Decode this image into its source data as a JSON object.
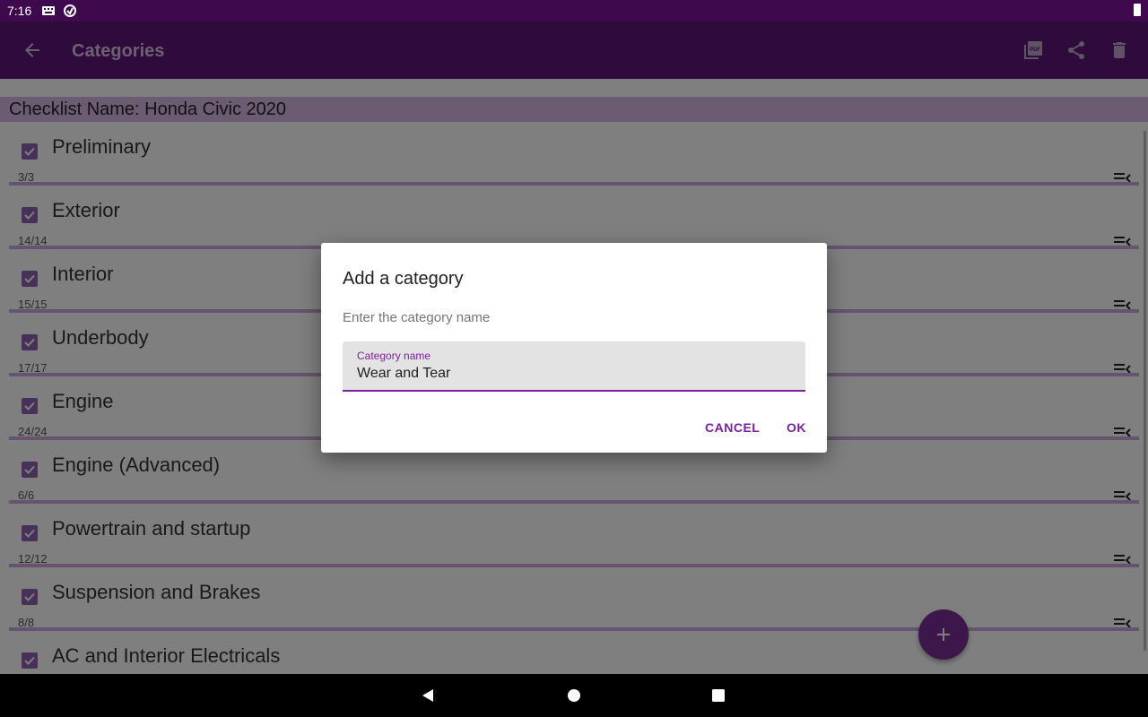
{
  "status_bar": {
    "time": "7:16",
    "icons": [
      "keyboard-icon",
      "sync-icon",
      "battery-icon"
    ]
  },
  "app_bar": {
    "title": "Categories",
    "actions": [
      "back-arrow-icon",
      "pdf-icon",
      "share-icon",
      "delete-icon"
    ]
  },
  "checklist": {
    "header": "Checklist Name: Honda Civic 2020"
  },
  "categories": [
    {
      "name": "Preliminary",
      "count": "3/3",
      "checked": true
    },
    {
      "name": "Exterior",
      "count": "14/14",
      "checked": true
    },
    {
      "name": "Interior",
      "count": "15/15",
      "checked": true
    },
    {
      "name": "Underbody",
      "count": "17/17",
      "checked": true
    },
    {
      "name": "Engine",
      "count": "24/24",
      "checked": true
    },
    {
      "name": "Engine (Advanced)",
      "count": "6/6",
      "checked": true
    },
    {
      "name": "Powertrain and startup",
      "count": "12/12",
      "checked": true
    },
    {
      "name": "Suspension and Brakes",
      "count": "8/8",
      "checked": true
    },
    {
      "name": "AC and Interior Electricals",
      "count": "",
      "checked": true
    }
  ],
  "dialog": {
    "title": "Add a category",
    "message": "Enter the category name",
    "field_label": "Category name",
    "field_value": "Wear and Tear",
    "cancel_label": "CANCEL",
    "ok_label": "OK"
  },
  "colors": {
    "primary": "#5f1478",
    "accent": "#7b1fa2",
    "status_bar": "#3f0a4d"
  }
}
